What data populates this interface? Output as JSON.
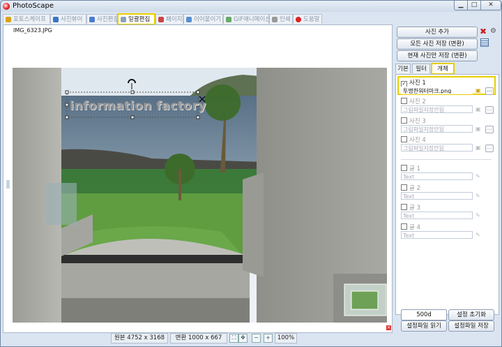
{
  "app": {
    "title": "PhotoScape"
  },
  "window_buttons": {
    "minimize": "▁",
    "maximize": "□",
    "close": "✕"
  },
  "tabs": [
    {
      "label": "포토스케이프",
      "icon_color": "#d9a21b"
    },
    {
      "label": "사진뷰어",
      "icon_color": "#3b74c4"
    },
    {
      "label": "사진편집",
      "icon_color": "#4a7bd0"
    },
    {
      "label": "일괄편집",
      "icon_color": "#8aa0c0",
      "active": true
    },
    {
      "label": "페이지",
      "icon_color": "#c44"
    },
    {
      "label": "이어붙이기",
      "icon_color": "#5a8fd0"
    },
    {
      "label": "GIF애니메이션",
      "icon_color": "#6a6"
    },
    {
      "label": "인쇄",
      "icon_color": "#999"
    },
    {
      "label": "도움말",
      "icon_color": "#d22"
    }
  ],
  "canvas": {
    "filename": "IMG_6323.JPG",
    "watermark_text": "information factory"
  },
  "statusbar": {
    "original": "원본 4752 x 3168",
    "converted": "변환 1000 x 667",
    "zoom": "100%"
  },
  "right_panel": {
    "add_photo": "사진 추가",
    "save_all": "모든 사진 저장 (변환)",
    "save_current": "현재 사진만 저장 (변환)",
    "tabs": [
      "기본",
      "필터",
      "개체"
    ],
    "active_tab": 2,
    "photos": [
      {
        "label": "사진 1",
        "checked": true,
        "value": "투명한워터마크.png"
      },
      {
        "label": "사진 2",
        "checked": false,
        "value": "그림파일지정안됨"
      },
      {
        "label": "사진 3",
        "checked": false,
        "value": "그림파일지정안됨"
      },
      {
        "label": "사진 4",
        "checked": false,
        "value": "그림파일지정안됨"
      }
    ],
    "texts": [
      {
        "label": "글 1",
        "placeholder": "Text"
      },
      {
        "label": "글 2",
        "placeholder": "Text"
      },
      {
        "label": "글 3",
        "placeholder": "Text"
      },
      {
        "label": "글 4",
        "placeholder": "Text"
      }
    ],
    "size_value": "500d",
    "reset_settings": "설정 초기화",
    "load_settings": "설정파일 읽기",
    "save_settings": "설정파일 저장"
  }
}
